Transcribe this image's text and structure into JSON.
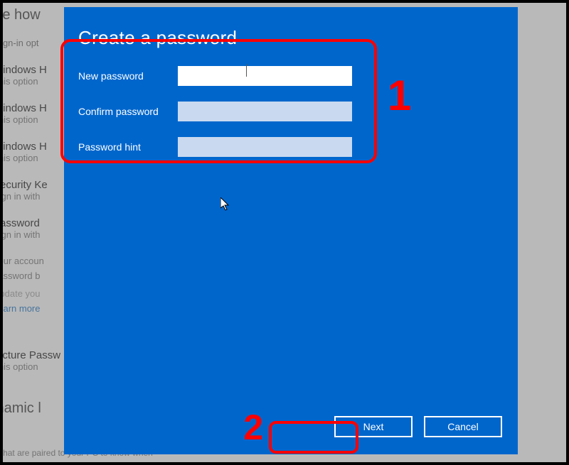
{
  "background": {
    "heading": "nage how",
    "subtext": "ct a sign-in opt",
    "options": [
      {
        "title": "Windows H",
        "desc": "This option"
      },
      {
        "title": "Windows H",
        "desc": "This option"
      },
      {
        "title": "Windows H",
        "desc": "This option"
      },
      {
        "title": "Security Ke",
        "desc": "Sign in with"
      },
      {
        "title": "Password",
        "desc": "Sign in with"
      }
    ],
    "paragraph1": "Your accoun",
    "paragraph2": "password b",
    "update": "Update you",
    "link": "Learn more",
    "picture_title": "Picture Passw",
    "picture_desc": "This option",
    "dynamic": "Dynamic l",
    "footer": "dows can use devices that are paired to your PC to know when"
  },
  "dialog": {
    "title": "Create a password",
    "fields": {
      "new_password": {
        "label": "New password",
        "value": ""
      },
      "confirm_password": {
        "label": "Confirm password",
        "value": ""
      },
      "password_hint": {
        "label": "Password hint",
        "value": ""
      }
    },
    "buttons": {
      "next": "Next",
      "cancel": "Cancel"
    }
  },
  "annotations": {
    "label1": "1",
    "label2": "2"
  }
}
